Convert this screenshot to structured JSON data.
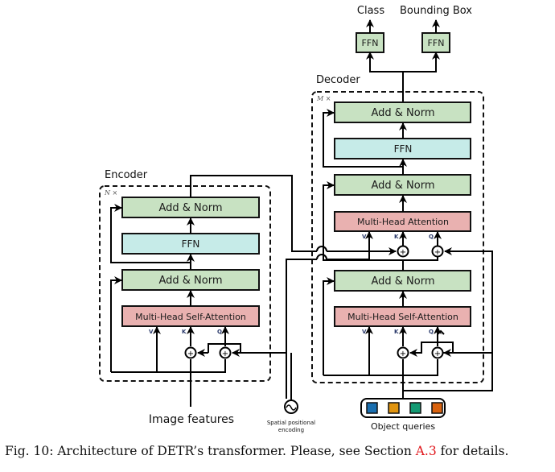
{
  "figure": {
    "outputs": {
      "class_label": "Class",
      "bbox_label": "Bounding Box"
    },
    "ffn_label": "FFN",
    "decoder": {
      "title": "Decoder",
      "repeat": "M ×",
      "blocks": {
        "top_add_norm": "Add & Norm",
        "ffn": "FFN",
        "mid_add_norm": "Add & Norm",
        "cross_attention": "Multi-Head Attention",
        "low_add_norm": "Add & Norm",
        "self_attention": "Multi-Head Self-Attention"
      }
    },
    "encoder": {
      "title": "Encoder",
      "repeat": "N ×",
      "blocks": {
        "top_add_norm": "Add & Norm",
        "ffn": "FFN",
        "low_add_norm": "Add & Norm",
        "self_attention": "Multi-Head Self-Attention"
      }
    },
    "inputs": {
      "v": "V",
      "k": "K",
      "q": "Q"
    },
    "image_features": "Image features",
    "spatial_encoding_line1": "Spatial positional",
    "spatial_encoding_line2": "encoding",
    "object_queries": "Object queries",
    "query_colors": [
      "#1a6fb0",
      "#e0940f",
      "#139a73",
      "#d9620e"
    ],
    "colors": {
      "add_norm_fill": "#c8e2c2",
      "ffn_fill": "#c6ebe8",
      "attention_fill": "#e9b1b0",
      "caption_ref": "#e0161b"
    }
  },
  "caption": {
    "prefix": "Fig. 10: Architecture of DETR’s transformer. Please, see Section ",
    "ref": "A.3",
    "suffix": " for details."
  }
}
